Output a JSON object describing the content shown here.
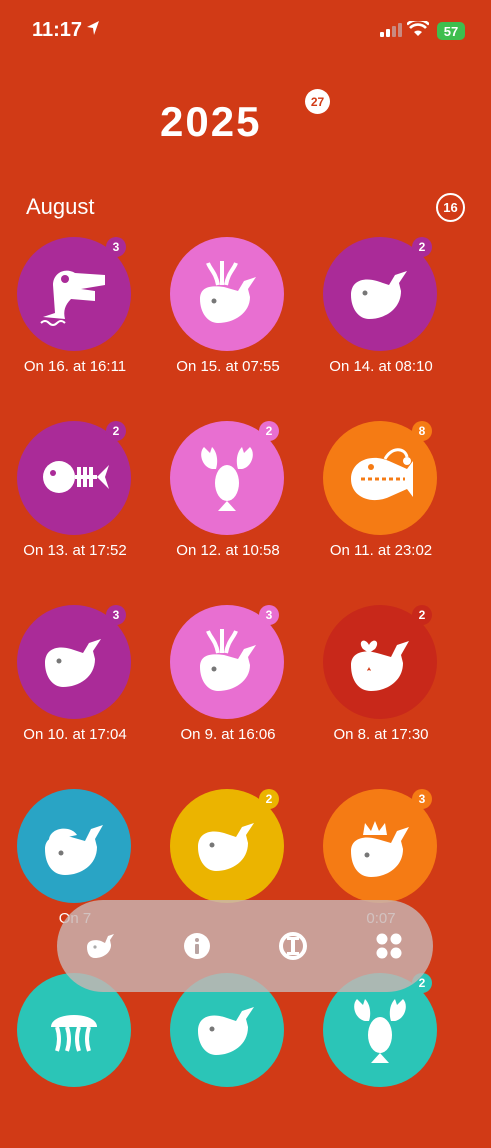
{
  "status": {
    "time": "11:17",
    "battery": "57"
  },
  "header": {
    "year": "2025",
    "year_count": "27"
  },
  "month": {
    "name": "August",
    "count": "16"
  },
  "entries": [
    {
      "label": "On 16. at 16:11",
      "badge": "3",
      "bg": "#AA2B98",
      "badge_bg": "#AA2B98",
      "icon": "dragon-icon"
    },
    {
      "label": "On 15. at 07:55",
      "badge": "",
      "bg": "#E86FD1",
      "badge_bg": "#E86FD1",
      "icon": "whale-spout-icon"
    },
    {
      "label": "On 14. at 08:10",
      "badge": "2",
      "bg": "#AA2B98",
      "badge_bg": "#AA2B98",
      "icon": "whale-icon"
    },
    {
      "label": "On 13. at 17:52",
      "badge": "2",
      "bg": "#AA2B98",
      "badge_bg": "#AA2B98",
      "icon": "fish-skeleton-icon"
    },
    {
      "label": "On 12. at 10:58",
      "badge": "2",
      "bg": "#E86FD1",
      "badge_bg": "#E86FD1",
      "icon": "lobster-icon"
    },
    {
      "label": "On 11. at 23:02",
      "badge": "8",
      "bg": "#F57B14",
      "badge_bg": "#F57B14",
      "icon": "anglerfish-icon"
    },
    {
      "label": "On 10. at 17:04",
      "badge": "3",
      "bg": "#AA2B98",
      "badge_bg": "#AA2B98",
      "icon": "whale-icon"
    },
    {
      "label": "On 9. at 16:06",
      "badge": "3",
      "bg": "#E86FD1",
      "badge_bg": "#E86FD1",
      "icon": "whale-spout-icon"
    },
    {
      "label": "On 8. at 17:30",
      "badge": "2",
      "bg": "#C8281A",
      "badge_bg": "#C8281A",
      "icon": "whale-heart-icon"
    },
    {
      "label": "On 7",
      "badge": "",
      "bg": "#29A4C5",
      "badge_bg": "#29A4C5",
      "icon": "whale-cap-icon"
    },
    {
      "label": "",
      "badge": "2",
      "bg": "#EBB400",
      "badge_bg": "#EBB400",
      "icon": "whale-icon"
    },
    {
      "label": "0:07",
      "badge": "3",
      "bg": "#F57B14",
      "badge_bg": "#F57B14",
      "icon": "whale-crown-icon"
    },
    {
      "label": "",
      "badge": "",
      "bg": "#2BC5B7",
      "badge_bg": "#2BC5B7",
      "icon": "jellyfish-icon"
    },
    {
      "label": "",
      "badge": "",
      "bg": "#2BC5B7",
      "badge_bg": "#2BC5B7",
      "icon": "whale-icon"
    },
    {
      "label": "",
      "badge": "2",
      "bg": "#2BC5B7",
      "badge_bg": "#2BC5B7",
      "icon": "lobster-icon"
    }
  ],
  "navbar": {
    "items": [
      "whale-nav-icon",
      "info-icon",
      "stats-icon",
      "grid-icon"
    ]
  },
  "colors": {
    "background": "#D13A16",
    "white": "#ffffff"
  }
}
